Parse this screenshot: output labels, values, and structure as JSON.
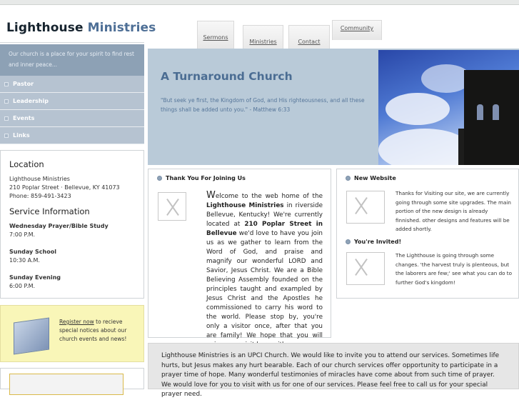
{
  "site": {
    "logo_part1": "Lighthouse",
    "logo_part2": "Ministries"
  },
  "nav_tabs": [
    {
      "label": "Sermons"
    },
    {
      "label": "Ministries"
    },
    {
      "label": "Contact"
    },
    {
      "label": "Community"
    }
  ],
  "sidebar": {
    "intro": "Our church is a place for your spirit to find rest and inner peace...",
    "items": [
      {
        "label": "Pastor"
      },
      {
        "label": "Leadership"
      },
      {
        "label": "Events"
      },
      {
        "label": "Links"
      }
    ]
  },
  "location": {
    "heading": "Location",
    "name": "Lighthouse Ministries",
    "address": "210 Poplar Street · Bellevue, KY 41073",
    "phone": "Phone: 859-491-3423"
  },
  "service": {
    "heading": "Service Information",
    "times": [
      {
        "day": "Wednesday Prayer/Bible Study",
        "time": "7:00 P.M."
      },
      {
        "day": "Sunday School",
        "time": "10:30 A.M."
      },
      {
        "day": "Sunday Evening",
        "time": "6:00 P.M."
      }
    ]
  },
  "register": {
    "link": "Register now",
    "text": " to recieve special notices about our church events and news!"
  },
  "hero": {
    "title": "A Turnaround Church",
    "quote": "\"But seek ye first, the Kingdom of God, and His righteousness, and all these things shall be added unto you.\" - Matthew 6:33"
  },
  "welcome": {
    "title": "Thank You For Joining Us",
    "drop": "W",
    "p1": "elcome to the web home of the ",
    "b1": "Lighthouse Ministries",
    "p2": " in riverside Bellevue, Kentucky! We're currently located at ",
    "b2": "210 Poplar Street in Bellevue",
    "p3": " we'd love to have you join us as we gather to learn from the Word of God, and praise and magnify our wonderful LORD and Savior, Jesus Christ. We are a Bible Believing Assembly founded on the principles taught and exampled by Jesus Christ and the Apostles he commissioned to carry his word to the world. Please stop by, you're only a visitor once, after that you are family! We hope that you will enjoy your visit here with us."
  },
  "news": [
    {
      "title": "New Website",
      "text": "Thanks for Visiting our site, we are currently going through some site upgrades. The main portion of the new design is already finnished. other designs and features will be added shortly."
    },
    {
      "title": "You're Invited!",
      "text": "The Lighthouse is going through some changes. 'the harvest truly is plenteous, but the laborers are few;' see what you can do to further God's kingdom!"
    }
  ],
  "bottom": "Lighthouse Ministries is an UPCI Church. We would like to invite you to attend our services. Sometimes life hurts, but Jesus makes any hurt bearable. Each of our church services offer opportunity to participate in a prayer time of hope. Many wonderful testimonies of miracles have come about from such time of prayer. We would love for you to visit with us for one of our services. Please feel free to call us for your special prayer need."
}
